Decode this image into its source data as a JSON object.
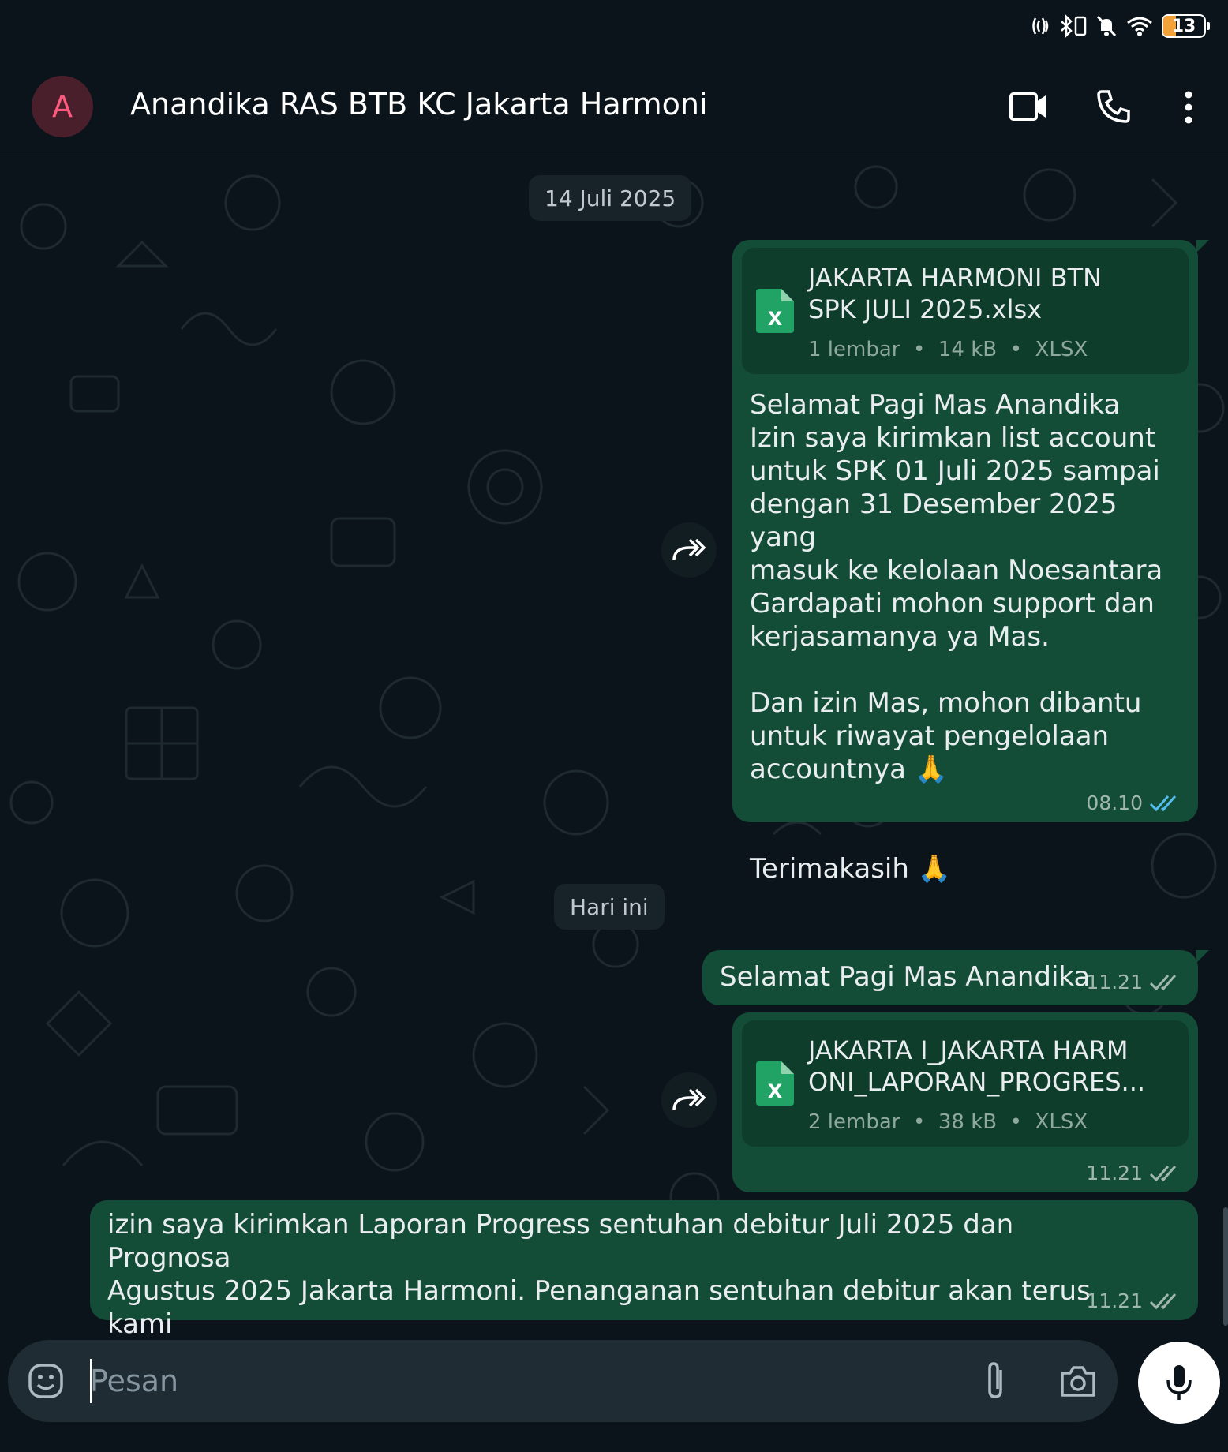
{
  "status_bar": {
    "battery": "13"
  },
  "header": {
    "avatar_letter": "A",
    "contact_name": "Anandika RAS BTB KC Jakarta Harmoni"
  },
  "messages": {
    "date1": "14 Juli 2025",
    "doc1": {
      "name_line1": "JAKARTA HARMONI BTN",
      "name_line2": "SPK JULI 2025.xlsx",
      "pages": "1 lembar",
      "size": "14 kB",
      "type": "XLSX"
    },
    "text1": "Selamat Pagi Mas Anandika\nIzin saya kirimkan list account\nuntuk SPK 01 Juli 2025 sampai\ndengan 31 Desember 2025 yang\nmasuk ke kelolaan Noesantara\nGardapati mohon support dan\nkerjasamanya ya Mas.\n\nDan izin Mas, mohon dibantu\nuntuk riwayat pengelolaan\naccountnya 🙏\n\n\nTerimakasih 🙏",
    "time1": "08.10",
    "date2": "Hari ini",
    "text2": "Selamat Pagi Mas Anandika",
    "time2": "11.21",
    "doc2": {
      "name_line1": "JAKARTA I_JAKARTA HARM",
      "name_line2": "ONI_LAPORAN_PROGRES...",
      "pages": "2 lembar",
      "size": "38 kB",
      "type": "XLSX"
    },
    "time3": "11.21",
    "text3": "izin saya kirimkan Laporan Progress sentuhan debitur Juli 2025 dan Prognosa\nAgustus 2025 Jakarta Harmoni. Penanganan sentuhan debitur akan terus kami\nmaksimalkan. Terimakasih",
    "time4": "11.21"
  },
  "composer": {
    "placeholder": "Pesan"
  },
  "icons": {
    "header": [
      "video-call-icon",
      "phone-icon",
      "more-vert-icon"
    ],
    "composer": [
      "emoji-icon",
      "attach-icon",
      "camera-icon",
      "mic-icon"
    ],
    "message": [
      "forward-icon",
      "xlsx-file-icon",
      "double-check-icon"
    ]
  },
  "colors": {
    "outgoing_bubble": "#144d37",
    "background": "#0b141a",
    "read_tick": "#53bdeb",
    "avatar_bg": "#4a1f2c",
    "avatar_fg": "#ff5a7d"
  }
}
